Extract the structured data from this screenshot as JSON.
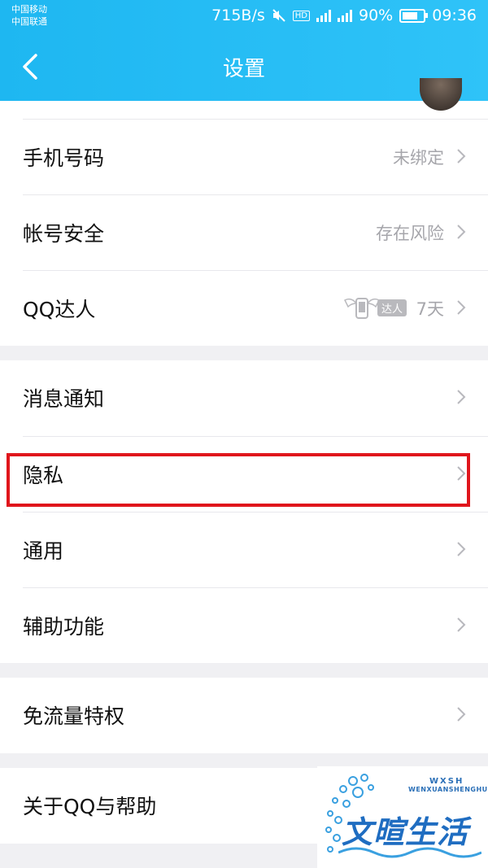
{
  "status_bar": {
    "carrier_1": "中国移动",
    "carrier_2": "中国联通",
    "speed": "715B/s",
    "hd": "HD",
    "battery_percent": "90%",
    "battery_level": 0.9,
    "time": "09:36"
  },
  "header": {
    "title": "设置"
  },
  "groups": [
    {
      "items": [
        {
          "label": "手机号码",
          "value": "未绑定"
        },
        {
          "label": "帐号安全",
          "value": "存在风险"
        },
        {
          "label": "QQ达人",
          "badge": "达人",
          "value": "7天"
        }
      ]
    },
    {
      "items": [
        {
          "label": "消息通知"
        },
        {
          "label": "隐私"
        },
        {
          "label": "通用"
        },
        {
          "label": "辅助功能"
        }
      ]
    },
    {
      "items": [
        {
          "label": "免流量特权"
        }
      ]
    },
    {
      "items": [
        {
          "label": "关于QQ与帮助"
        }
      ]
    }
  ],
  "watermark": {
    "abbr": "WXSH",
    "pinyin": "WENXUANSHENGHUO",
    "name": "文暄生活"
  },
  "colors": {
    "header": "#1eb7f1",
    "highlight": "#e0151c"
  }
}
